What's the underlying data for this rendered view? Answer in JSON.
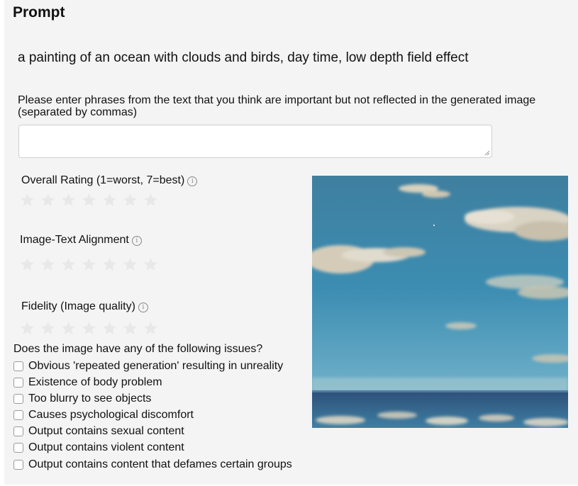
{
  "prompt": {
    "heading": "Prompt",
    "text": "a painting of an ocean with clouds and birds, day time, low depth field effect"
  },
  "phrases": {
    "label": "Please enter phrases from the text that you think are important but not reflected in the generated image (separated by commas)",
    "value": "",
    "placeholder": ""
  },
  "ratings": [
    {
      "label": "Overall Rating (1=worst, 7=best)",
      "max_stars": 7,
      "selected": 0
    },
    {
      "label": "Image-Text Alignment",
      "max_stars": 7,
      "selected": 0
    },
    {
      "label": "Fidelity (Image quality)",
      "max_stars": 7,
      "selected": 0
    }
  ],
  "info_icon": "info-circle-icon",
  "issues": {
    "heading": "Does the image have any of the following issues?",
    "options": [
      {
        "label": "Obvious 'repeated generation' resulting in unreality",
        "checked": false
      },
      {
        "label": "Existence of body problem",
        "checked": false
      },
      {
        "label": "Too blurry to see objects",
        "checked": false
      },
      {
        "label": "Causes psychological discomfort",
        "checked": false
      },
      {
        "label": "Output contains sexual content",
        "checked": false
      },
      {
        "label": "Output contains violent content",
        "checked": false
      },
      {
        "label": "Output contains content that defames certain groups",
        "checked": false
      }
    ]
  },
  "colors": {
    "panel_bg": "#f4f4f4",
    "star_empty": "#e8e8e8",
    "text": "#111111"
  }
}
